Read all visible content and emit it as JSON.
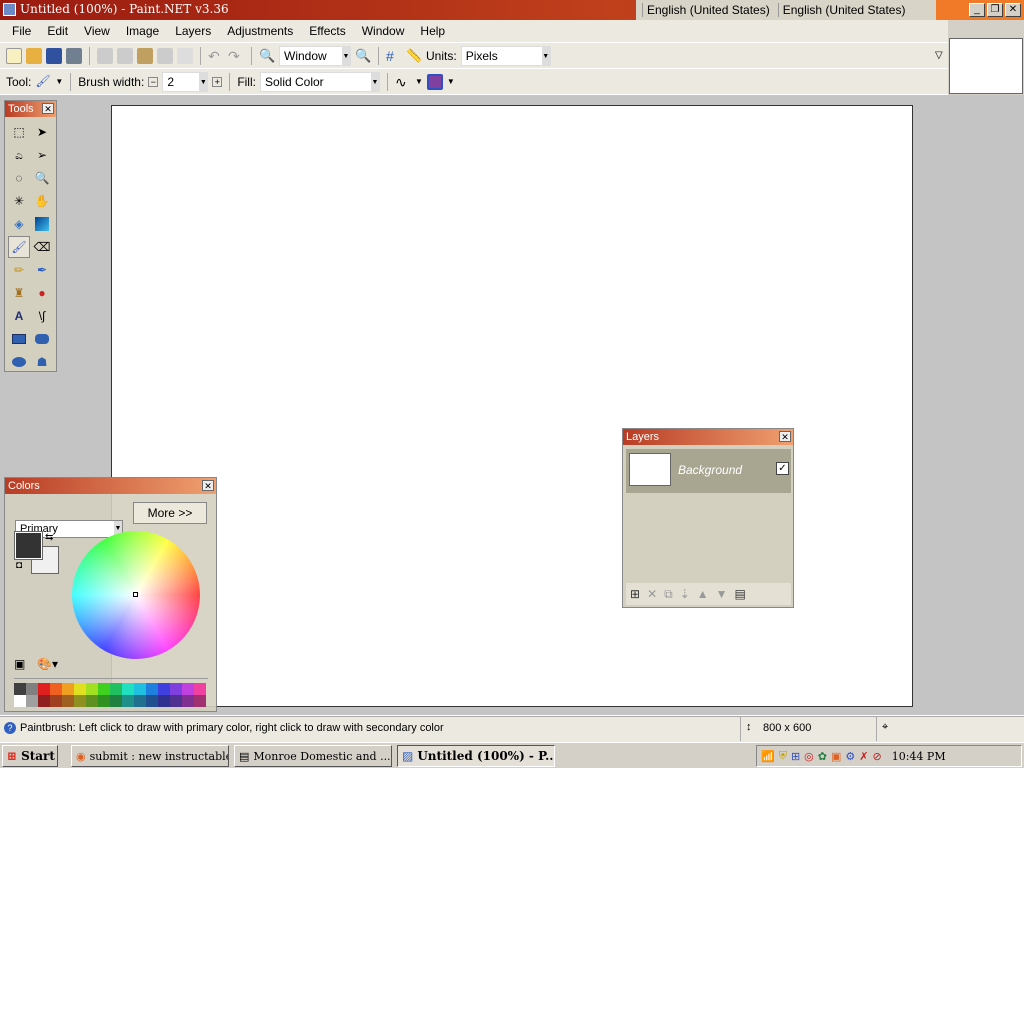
{
  "window": {
    "title": "Untitled (100%) - Paint.NET v3.36"
  },
  "language_bar": [
    "English (United States)",
    "English (United States)"
  ],
  "menu": [
    "File",
    "Edit",
    "View",
    "Image",
    "Layers",
    "Adjustments",
    "Effects",
    "Window",
    "Help"
  ],
  "toolbar": {
    "zoom_value": "Window",
    "units_label": "Units:",
    "units_value": "Pixels"
  },
  "toolbar2": {
    "tool_label": "Tool:",
    "brush_width_label": "Brush width:",
    "brush_width_value": "2",
    "fill_label": "Fill:",
    "fill_value": "Solid Color"
  },
  "tools_panel": {
    "title": "Tools"
  },
  "colors_panel": {
    "title": "Colors",
    "mode": "Primary",
    "more_button": "More >>",
    "primary": "#333333",
    "secondary": "#f0f0f0",
    "palette_top": [
      "#404040",
      "#808080",
      "#e02020",
      "#f06020",
      "#f0a020",
      "#e0e020",
      "#a0e020",
      "#40d020",
      "#20c060",
      "#20e0c0",
      "#20c0e0",
      "#2080e0",
      "#4040e0",
      "#8040e0",
      "#c040e0",
      "#f040a0"
    ],
    "palette_bottom": [
      "#ffffff",
      "#a0a0a0",
      "#902020",
      "#a04020",
      "#a06020",
      "#909020",
      "#609020",
      "#309020",
      "#208040",
      "#20908a",
      "#207090",
      "#205090",
      "#303090",
      "#503090",
      "#803090",
      "#a03070"
    ]
  },
  "layers_panel": {
    "title": "Layers",
    "layers": [
      {
        "name": "Background",
        "visible": true
      }
    ]
  },
  "status": {
    "hint": "Paintbrush: Left click to draw with primary color, right click to draw with secondary color",
    "image_size": "800 x 600"
  },
  "taskbar": {
    "start": "Start",
    "tasks": [
      "submit : new instructable ...",
      "Monroe Domestic and ...",
      "Untitled (100%) - P..."
    ],
    "clock": "10:44 PM"
  }
}
